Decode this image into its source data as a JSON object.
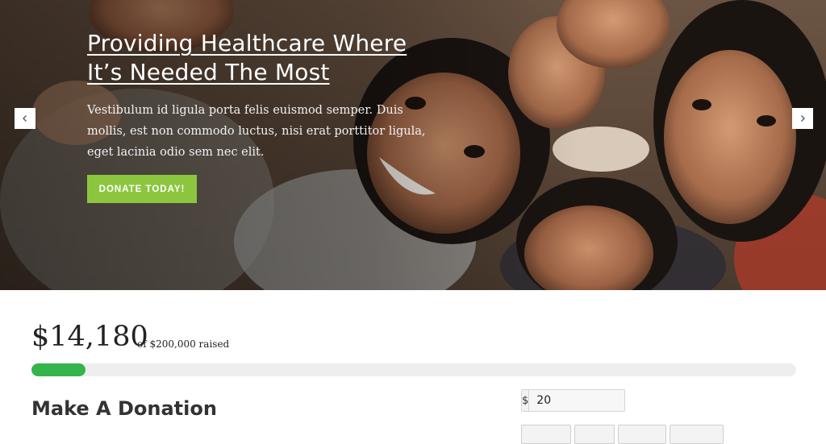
{
  "hero": {
    "title": "Providing Healthcare Where It’s Needed The Most",
    "body": "Vestibulum id ligula porta felis euismod semper. Duis mollis, est non commodo luctus, nisi erat porttitor ligula, eget lacinia odio sem nec elit.",
    "cta_label": "DONATE TODAY!",
    "prev_icon": "chevron-left-icon",
    "next_icon": "chevron-right-icon",
    "image": "photo of smiling children"
  },
  "campaign": {
    "raised": "$14,180",
    "goal_text": "of $200,000 raised",
    "progress": 0.0709
  },
  "donation": {
    "heading": "Make A Donation",
    "currency_symbol": "$",
    "amount_value": "20"
  },
  "colors": {
    "accent_green": "#8cc63f",
    "progress_green": "#34b44a",
    "text_dark": "#333333"
  }
}
